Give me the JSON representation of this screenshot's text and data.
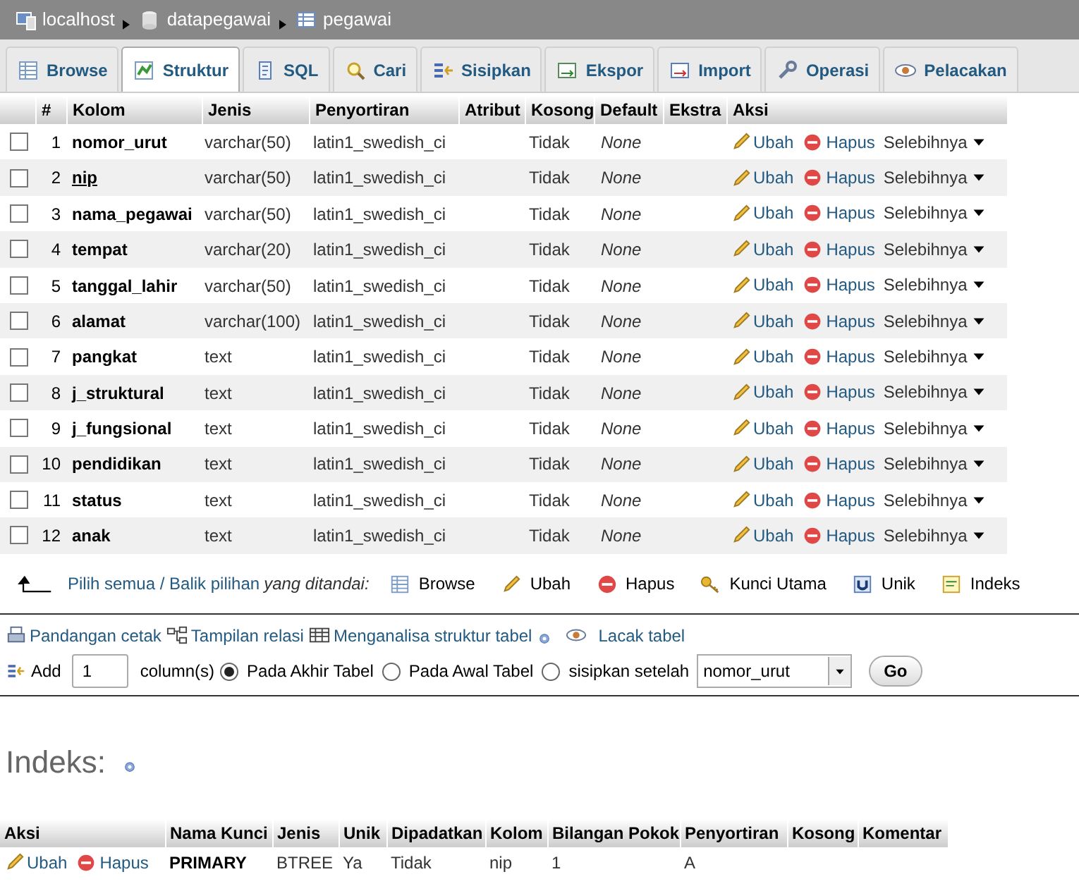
{
  "breadcrumb": [
    {
      "label": "localhost",
      "kind": "server"
    },
    {
      "label": "datapegawai",
      "kind": "database"
    },
    {
      "label": "pegawai",
      "kind": "table"
    }
  ],
  "tabs": [
    {
      "label": "Browse",
      "selected": false
    },
    {
      "label": "Struktur",
      "selected": true
    },
    {
      "label": "SQL",
      "selected": false
    },
    {
      "label": "Cari",
      "selected": false
    },
    {
      "label": "Sisipkan",
      "selected": false
    },
    {
      "label": "Ekspor",
      "selected": false
    },
    {
      "label": "Import",
      "selected": false
    },
    {
      "label": "Operasi",
      "selected": false
    },
    {
      "label": "Pelacakan",
      "selected": false
    }
  ],
  "structure": {
    "columns": [
      "#",
      "Kolom",
      "Jenis",
      "Penyortiran",
      "Atribut",
      "Kosong",
      "Default",
      "Ekstra",
      "Aksi"
    ],
    "rows": [
      {
        "num": "1",
        "name": "nomor_urut",
        "type": "varchar(50)",
        "collation": "latin1_swedish_ci",
        "null": "Tidak",
        "default": "None",
        "primary": false,
        "checked": false
      },
      {
        "num": "2",
        "name": "nip",
        "type": "varchar(50)",
        "collation": "latin1_swedish_ci",
        "null": "Tidak",
        "default": "None",
        "primary": true,
        "checked": false
      },
      {
        "num": "3",
        "name": "nama_pegawai",
        "type": "varchar(50)",
        "collation": "latin1_swedish_ci",
        "null": "Tidak",
        "default": "None",
        "primary": false,
        "checked": false
      },
      {
        "num": "4",
        "name": "tempat",
        "type": "varchar(20)",
        "collation": "latin1_swedish_ci",
        "null": "Tidak",
        "default": "None",
        "primary": false,
        "checked": false
      },
      {
        "num": "5",
        "name": "tanggal_lahir",
        "type": "varchar(50)",
        "collation": "latin1_swedish_ci",
        "null": "Tidak",
        "default": "None",
        "primary": false,
        "checked": false
      },
      {
        "num": "6",
        "name": "alamat",
        "type": "varchar(100)",
        "collation": "latin1_swedish_ci",
        "null": "Tidak",
        "default": "None",
        "primary": false,
        "checked": false
      },
      {
        "num": "7",
        "name": "pangkat",
        "type": "text",
        "collation": "latin1_swedish_ci",
        "null": "Tidak",
        "default": "None",
        "primary": false,
        "checked": false
      },
      {
        "num": "8",
        "name": "j_struktural",
        "type": "text",
        "collation": "latin1_swedish_ci",
        "null": "Tidak",
        "default": "None",
        "primary": false,
        "checked": false
      },
      {
        "num": "9",
        "name": "j_fungsional",
        "type": "text",
        "collation": "latin1_swedish_ci",
        "null": "Tidak",
        "default": "None",
        "primary": false,
        "checked": false
      },
      {
        "num": "10",
        "name": "pendidikan",
        "type": "text",
        "collation": "latin1_swedish_ci",
        "null": "Tidak",
        "default": "None",
        "primary": false,
        "checked": false
      },
      {
        "num": "11",
        "name": "status",
        "type": "text",
        "collation": "latin1_swedish_ci",
        "null": "Tidak",
        "default": "None",
        "primary": false,
        "checked": false
      },
      {
        "num": "12",
        "name": "anak",
        "type": "text",
        "collation": "latin1_swedish_ci",
        "null": "Tidak",
        "default": "None",
        "primary": false,
        "checked": false
      }
    ],
    "row_actions": [
      {
        "edit": "Ubah",
        "drop": "Hapus",
        "more": "Selebihnya"
      },
      {
        "edit": "Ubah",
        "drop": "Hapus",
        "more": "Selebihnya"
      },
      {
        "edit": "Ubah",
        "drop": "Hapus",
        "more": "Selebihnya"
      },
      {
        "edit": "Ubah",
        "drop": "Hapus",
        "more": "Selebihnya"
      },
      {
        "edit": "Ubah",
        "drop": "Hapus",
        "more": "Selebihnya"
      },
      {
        "edit": "Ubah",
        "drop": "Hapus",
        "more": "Selebihnya"
      },
      {
        "edit": "Ubah",
        "drop": "Hapus",
        "more": "Selebihnya"
      },
      {
        "edit": "Ubah",
        "drop": "Hapus",
        "more": "Selebihnya"
      },
      {
        "edit": "Ubah",
        "drop": "Hapus",
        "more": "Selebihnya"
      },
      {
        "edit": "Ubah",
        "drop": "Hapus",
        "more": "Selebihnya"
      },
      {
        "edit": "Ubah",
        "drop": "Hapus",
        "more": "Selebihnya"
      },
      {
        "edit": "Ubah",
        "drop": "Hapus",
        "more": "Selebihnya"
      }
    ]
  },
  "bulk": {
    "select_all": "Pilih semua / Balik pilihan",
    "with_selected": "yang ditandai:",
    "actions": [
      "Browse",
      "Ubah",
      "Hapus",
      "Kunci Utama",
      "Unik",
      "Indeks"
    ]
  },
  "links": [
    "Pandangan cetak",
    "Tampilan relasi",
    "Menganalisa struktur tabel",
    "Lacak tabel"
  ],
  "add_column": {
    "label": "Add",
    "count": "1",
    "unit": "column(s)",
    "positions": [
      {
        "label": "Pada Akhir Tabel",
        "selected": true
      },
      {
        "label": "Pada Awal Tabel",
        "selected": false
      },
      {
        "label": "sisipkan setelah",
        "selected": false
      }
    ],
    "after": "nomor_urut",
    "go": "Go"
  },
  "indexes": {
    "title": "Indeks:",
    "columns": [
      "Aksi",
      "Nama Kunci",
      "Jenis",
      "Unik",
      "Dipadatkan",
      "Kolom",
      "Bilangan Pokok",
      "Penyortiran",
      "Kosong",
      "Komentar"
    ],
    "rows": [
      {
        "edit": "Ubah",
        "drop": "Hapus",
        "key": "PRIMARY",
        "type": "BTREE",
        "unique": "Ya",
        "packed": "Tidak",
        "column": "nip",
        "cardinality": "1",
        "collation": "A"
      }
    ]
  }
}
